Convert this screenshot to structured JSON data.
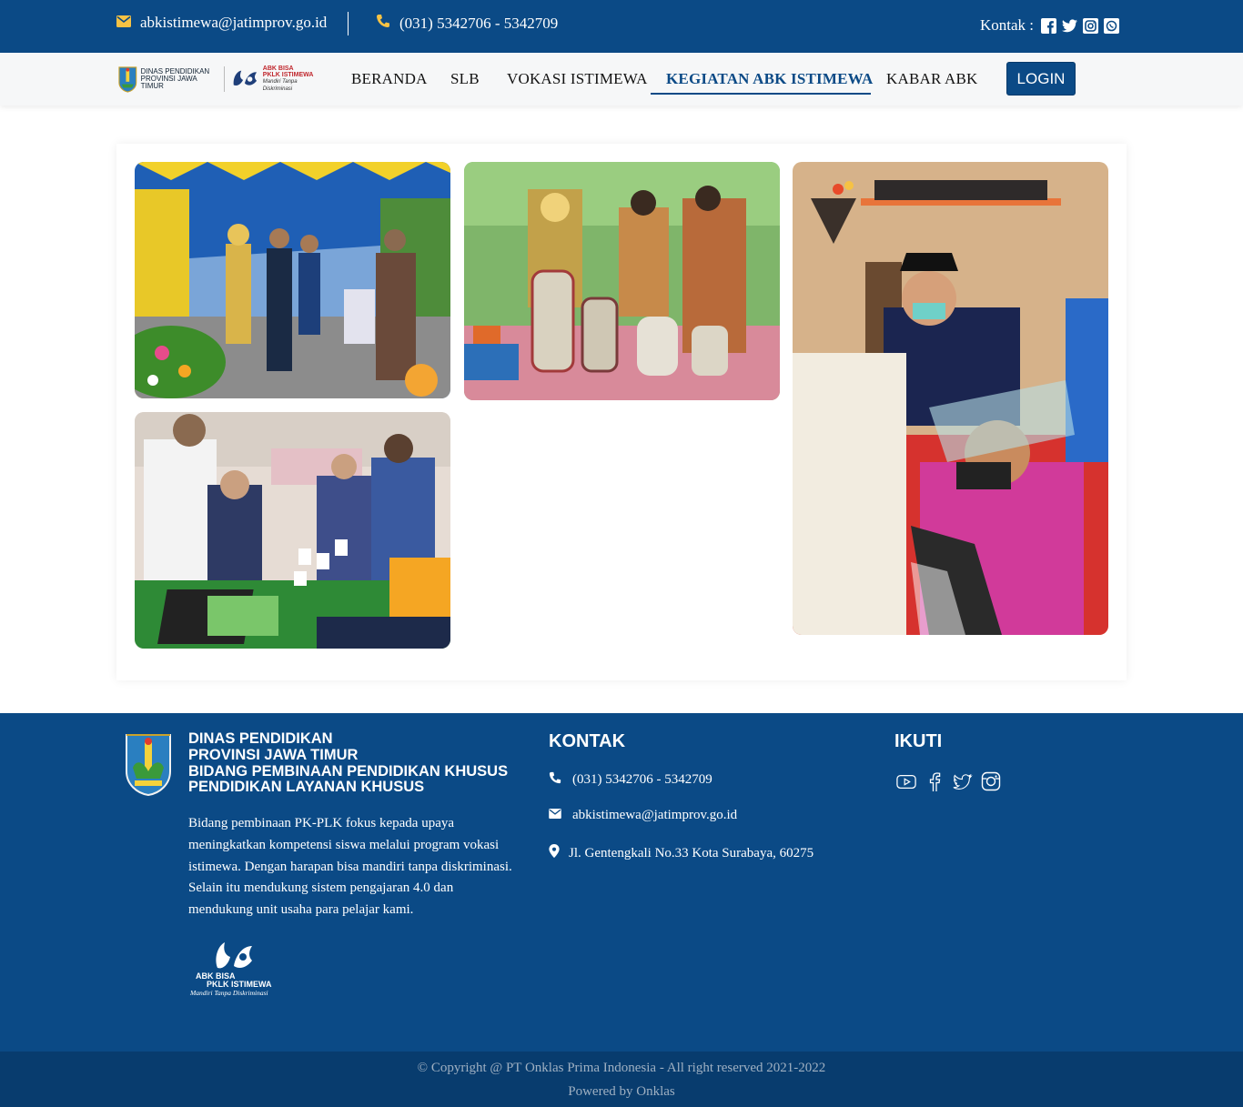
{
  "topbar": {
    "email": "abkistimewa@jatimprov.go.id",
    "phone": "(031) 5342706 - 5342709",
    "kontak_label": "Kontak :",
    "icons": [
      "facebook-square-icon",
      "twitter-icon",
      "instagram-icon",
      "whatsapp-icon"
    ]
  },
  "logo": {
    "dinas_line1": "DINAS PENDIDIKAN",
    "dinas_line2": "PROVINSI JAWA TIMUR",
    "abk_line1": "ABK BISA",
    "abk_line2": "PKLK ISTIMEWA",
    "abk_tagline": "Mandiri Tanpa Diskriminasi"
  },
  "nav": {
    "items": [
      {
        "label": "BERANDA"
      },
      {
        "label": "SLB"
      },
      {
        "label": "VOKASI ISTIMEWA"
      },
      {
        "label": "KEGIATAN ABK ISTIMEWA",
        "active": true
      },
      {
        "label": "KABAR ABK"
      }
    ],
    "login": "LOGIN"
  },
  "gallery": {
    "photos": [
      {
        "name": "photo-exhibition-tent"
      },
      {
        "name": "photo-handicraft-display"
      },
      {
        "name": "photo-batik-workshop"
      },
      {
        "name": "photo-computer-demo"
      }
    ]
  },
  "footer": {
    "title_lines": [
      "DINAS PENDIDIKAN",
      "PROVINSI JAWA TIMUR",
      "BIDANG PEMBINAAN PENDIDIKAN KHUSUS",
      "PENDIDIKAN LAYANAN KHUSUS"
    ],
    "description": "Bidang pembinaan PK-PLK fokus kepada upaya meningkatkan kompetensi siswa melalui program vokasi istimewa. Dengan harapan bisa mandiri tanpa diskriminasi. Selain itu mendukung sistem pengajaran 4.0 dan mendukung unit usaha para pelajar kami.",
    "logo_line1": "ABK BISA",
    "logo_line2": "PKLK ISTIMEWA",
    "logo_tagline": "Mandiri Tanpa Diskriminasi",
    "kontak_heading": "KONTAK",
    "phone": "(031) 5342706 - 5342709",
    "email": "abkistimewa@jatimprov.go.id",
    "address": "Jl. Gentengkali No.33 Kota Surabaya, 60275",
    "ikuti_heading": "IKUTI",
    "social_icons": [
      "youtube-icon",
      "facebook-icon",
      "twitter-icon",
      "instagram-icon"
    ]
  },
  "copyright": {
    "line1": "© Copyright @ PT Onklas Prima Indonesia - All right reserved 2021-2022",
    "line2": "Powered by Onklas"
  },
  "colors": {
    "primary": "#0b4a86",
    "copyright_bg": "#083c6e",
    "accent_yellow": "#f6c244"
  }
}
